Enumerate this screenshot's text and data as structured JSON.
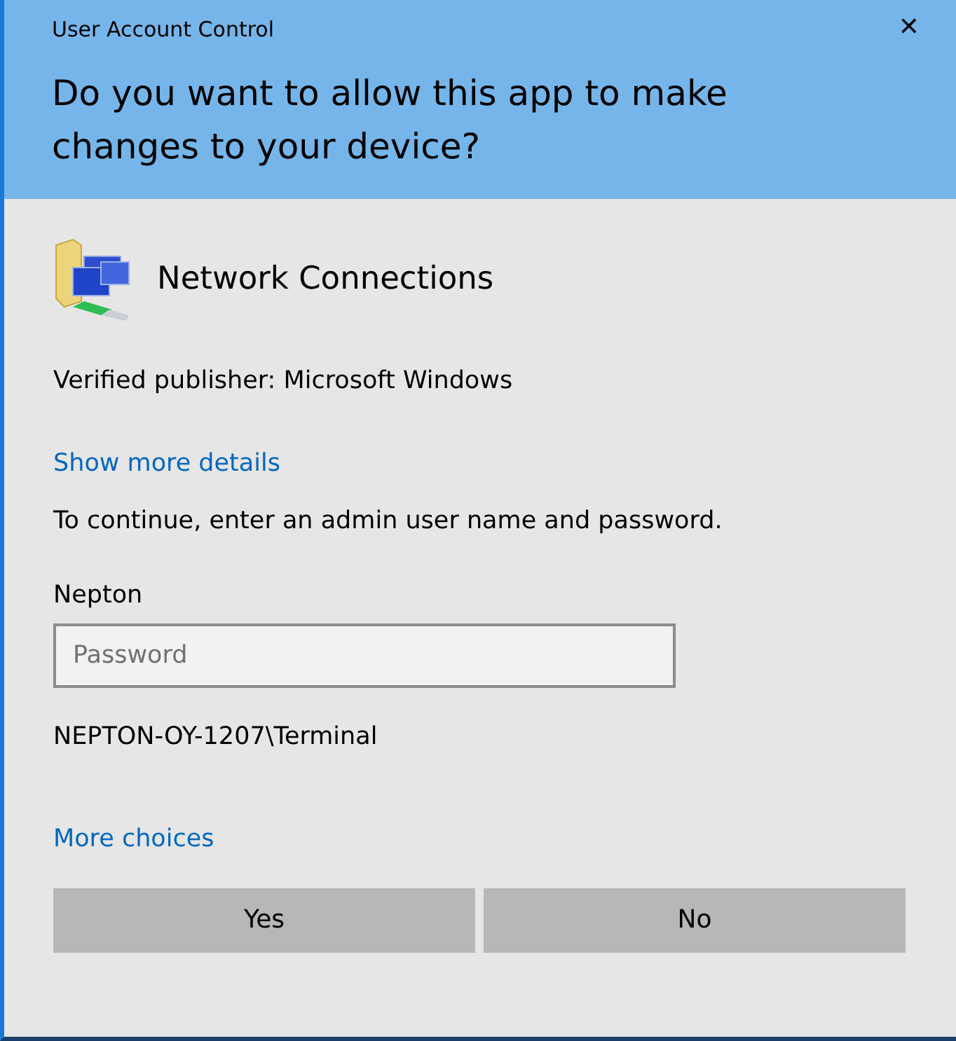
{
  "window": {
    "title": "User Account Control",
    "close": "✕"
  },
  "question": "Do you want to allow this app to make changes to your device?",
  "app": {
    "name": "Network Connections"
  },
  "publisher": "Verified publisher: Microsoft Windows",
  "details_link": "Show more details",
  "instruction": "To continue, enter an admin user name and password.",
  "username": "Nepton",
  "password": {
    "placeholder": "Password"
  },
  "domain": "NEPTON-OY-1207\\Terminal",
  "more_choices": "More choices",
  "buttons": [
    "Yes",
    "No"
  ]
}
